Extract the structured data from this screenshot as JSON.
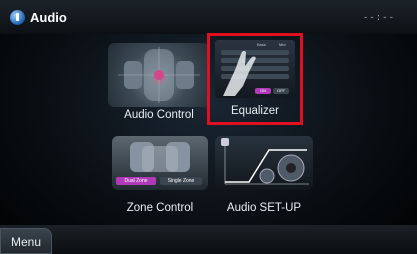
{
  "header": {
    "title": "Audio",
    "clock": "--:--"
  },
  "tiles": [
    {
      "label": "Audio Control"
    },
    {
      "label": "Equalizer",
      "selected": true,
      "preview": {
        "col1": "Bass",
        "col2": "Mid",
        "on": "ON",
        "off": "OFF"
      }
    },
    {
      "label": "Zone Control",
      "preview": {
        "dual": "Dual Zone",
        "single": "Single Zone"
      }
    },
    {
      "label": "Audio SET-UP"
    }
  ],
  "footer": {
    "menu_label": "Menu"
  },
  "colors": {
    "selection": "#e01020",
    "accent": "#b03ab8"
  }
}
